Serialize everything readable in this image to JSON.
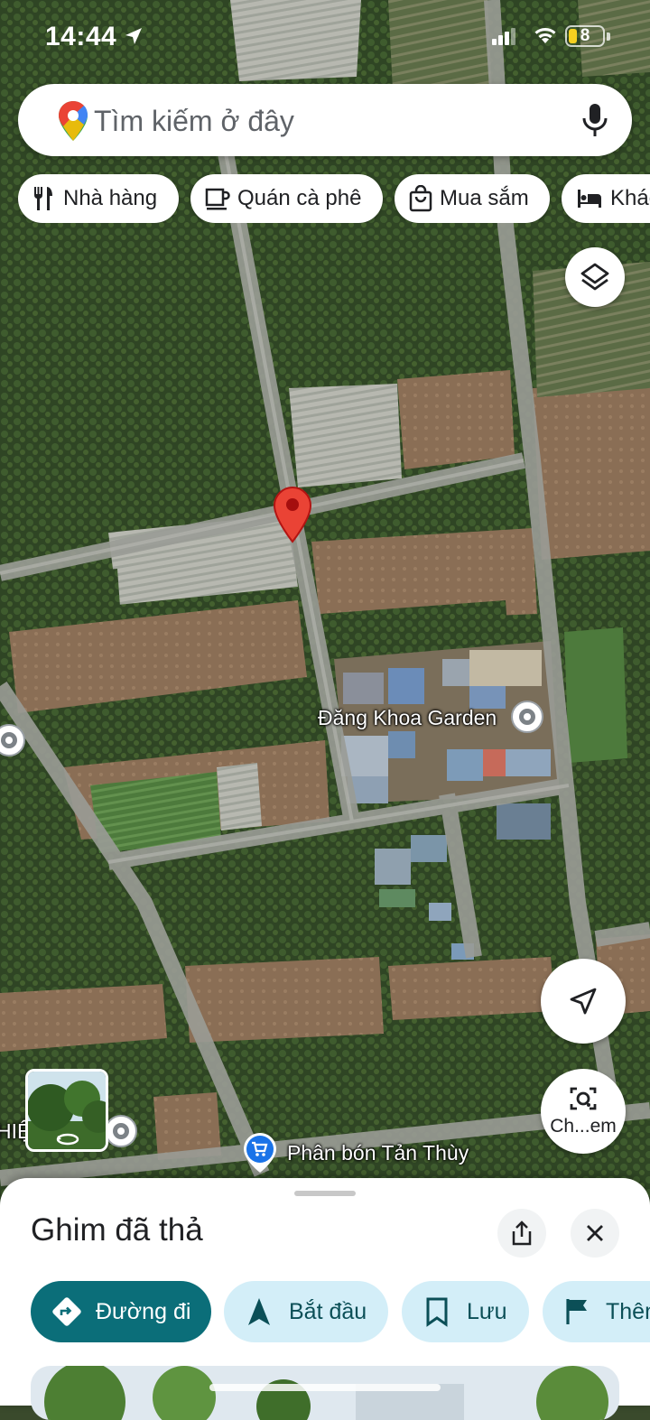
{
  "status_bar": {
    "time": "14:44",
    "battery": "8"
  },
  "search": {
    "placeholder": "Tìm kiếm ở đây"
  },
  "chips": [
    {
      "label": "Nhà hàng",
      "icon": "restaurant-icon"
    },
    {
      "label": "Quán cà phê",
      "icon": "coffee-icon"
    },
    {
      "label": "Mua sắm",
      "icon": "shopping-bag-icon"
    },
    {
      "label": "Khác",
      "icon": "hotel-bed-icon"
    }
  ],
  "map": {
    "places": [
      {
        "label": "Đăng Khoa Garden",
        "icon": "place-dot-icon"
      },
      {
        "label": "Phân bón Tản Thùy",
        "icon": "shopping-cart-pin-icon"
      },
      {
        "label": "HIỆ",
        "icon": "place-dot-icon"
      }
    ],
    "dropped_pin_color": "#ea4335"
  },
  "controls": {
    "lens_label": "Ch...em"
  },
  "sheet": {
    "title": "Ghim đã thả",
    "actions": [
      {
        "label": "Đường đi",
        "icon": "directions-icon",
        "primary": true
      },
      {
        "label": "Bắt đầu",
        "icon": "navigation-arrow-icon"
      },
      {
        "label": "Lưu",
        "icon": "bookmark-icon"
      },
      {
        "label": "Thêm",
        "icon": "flag-icon"
      }
    ]
  },
  "colors": {
    "primary": "#0b6e79",
    "chip_tint": "#d3eef8",
    "text": "#202124"
  }
}
